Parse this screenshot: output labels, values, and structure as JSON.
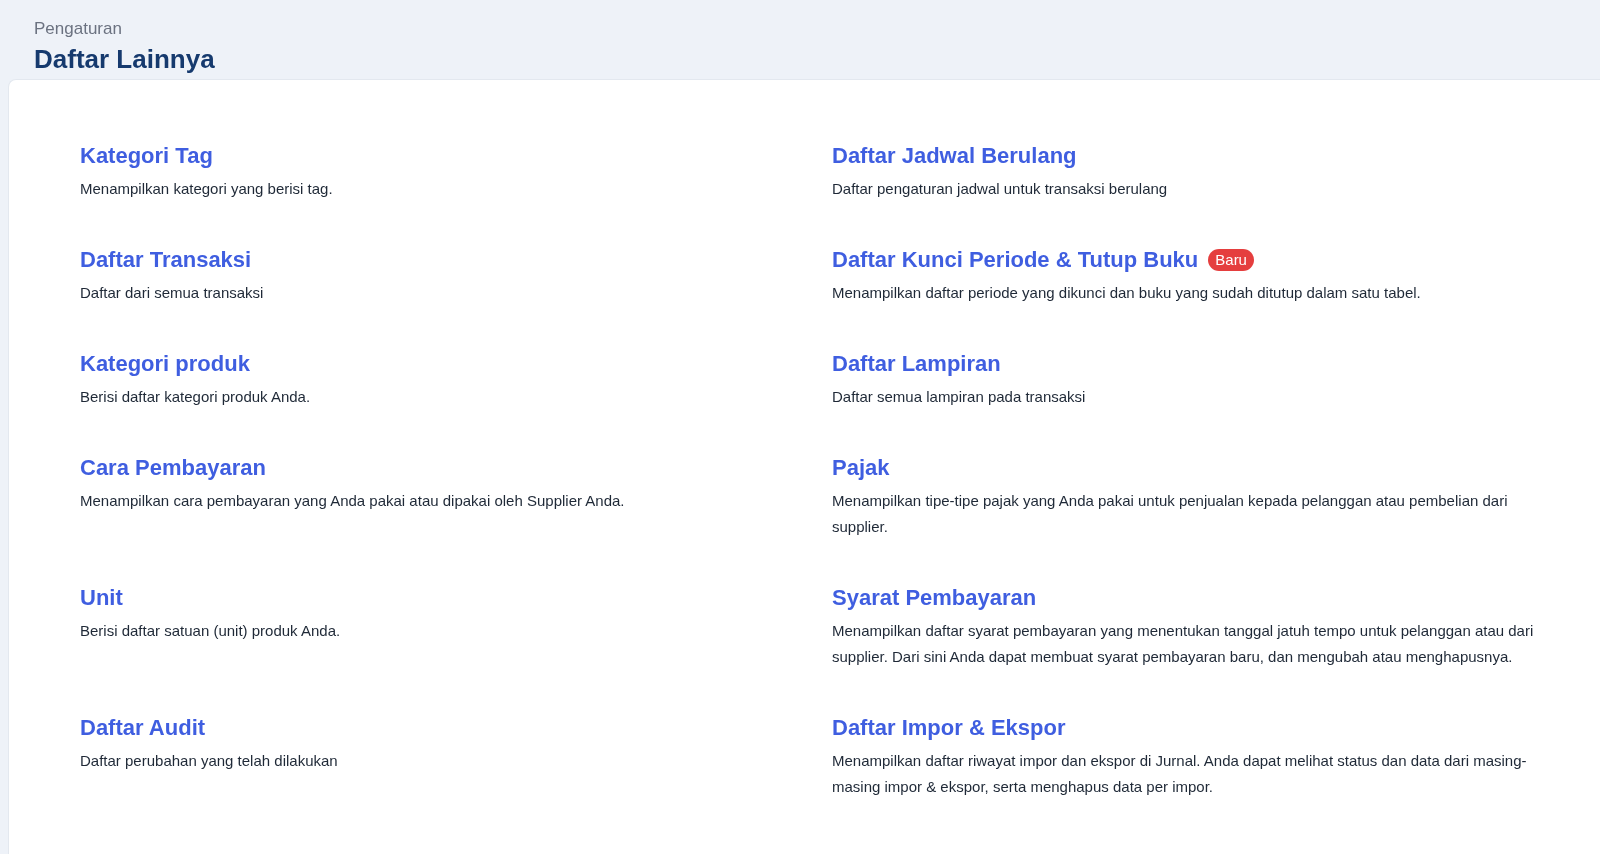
{
  "header": {
    "breadcrumb": "Pengaturan",
    "title": "Daftar Lainnya"
  },
  "rows": [
    {
      "left": {
        "title": "Kategori Tag",
        "description": "Menampilkan kategori yang berisi tag."
      },
      "right": {
        "title": "Daftar Jadwal Berulang",
        "description": "Daftar pengaturan jadwal untuk transaksi berulang"
      }
    },
    {
      "left": {
        "title": "Daftar Transaksi",
        "description": "Daftar dari semua transaksi"
      },
      "right": {
        "title": "Daftar Kunci Periode & Tutup Buku",
        "badge": "Baru",
        "description": "Menampilkan daftar periode yang dikunci dan buku yang sudah ditutup dalam satu tabel."
      }
    },
    {
      "left": {
        "title": "Kategori produk",
        "description": "Berisi daftar kategori produk Anda."
      },
      "right": {
        "title": "Daftar Lampiran",
        "description": "Daftar semua lampiran pada transaksi"
      }
    },
    {
      "left": {
        "title": "Cara Pembayaran",
        "description": "Menampilkan cara pembayaran yang Anda pakai atau dipakai oleh Supplier Anda."
      },
      "right": {
        "title": "Pajak",
        "description": "Menampilkan tipe-tipe pajak yang Anda pakai untuk penjualan kepada pelanggan atau pembelian dari supplier."
      }
    },
    {
      "left": {
        "title": "Unit",
        "description": "Berisi daftar satuan (unit) produk Anda."
      },
      "right": {
        "title": "Syarat Pembayaran",
        "description": "Menampilkan daftar syarat pembayaran yang menentukan tanggal jatuh tempo untuk pelanggan atau dari supplier. Dari sini Anda dapat membuat syarat pembayaran baru, dan mengubah atau menghapusnya."
      }
    },
    {
      "left": {
        "title": "Daftar Audit",
        "description": "Daftar perubahan yang telah dilakukan"
      },
      "right": {
        "title": "Daftar Impor & Ekspor",
        "description": "Menampilkan daftar riwayat impor dan ekspor di Jurnal. Anda dapat melihat status dan data dari masing-masing impor & ekspor, serta menghapus data per impor."
      }
    }
  ]
}
